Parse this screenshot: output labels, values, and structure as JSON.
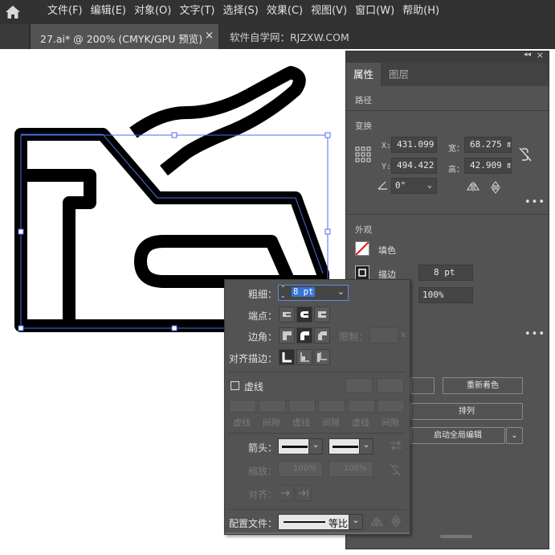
{
  "menubar": {
    "items": [
      "文件(F)",
      "编辑(E)",
      "对象(O)",
      "文字(T)",
      "选择(S)",
      "效果(C)",
      "视图(V)",
      "窗口(W)",
      "帮助(H)"
    ]
  },
  "tabs": {
    "active_title": "27.ai* @ 200% (CMYK/GPU 预览)",
    "close": "×",
    "second_title": "软件自学网：RJZXW.COM"
  },
  "panel": {
    "tab_properties": "属性",
    "tab_layers": "图层",
    "section_path": "路径",
    "section_transform": "变换",
    "x_label": "X:",
    "x_value": "431.099",
    "y_label": "Y:",
    "y_value": "494.422",
    "w_label": "宽：",
    "w_value": "68.275 m",
    "h_label": "高：",
    "h_value": "42.909 m",
    "angle_value": "0°",
    "more": "•••",
    "section_appearance": "外观",
    "fill_label": "填色",
    "stroke_label": "描边",
    "stroke_value": "8 pt",
    "opacity_value": "100%",
    "recolor_button": "重新着色",
    "arrange_button": "排列",
    "global_edit_button": "启动全局编辑"
  },
  "stroke_popup": {
    "weight_label": "粗细：",
    "weight_value": "8 pt",
    "cap_label": "端点：",
    "corner_label": "边角：",
    "limit_label": "限制：",
    "limit_suffix": "x",
    "align_label": "对齐描边：",
    "dashed_label": "虚线",
    "dash_labels": [
      "虚线",
      "间隙",
      "虚线",
      "间隙",
      "虚线",
      "间隙"
    ],
    "arrow_label": "箭头：",
    "scale_label": "缩放：",
    "scale_start": "100%",
    "scale_end": "100%",
    "align_arrow_label": "对齐：",
    "profile_label": "配置文件：",
    "profile_value": "等比"
  },
  "colors": {
    "menubar_bg": "#323232",
    "panel_bg": "#535353",
    "selection_blue": "#4a6fe8",
    "highlight_blue": "#3875d7"
  }
}
